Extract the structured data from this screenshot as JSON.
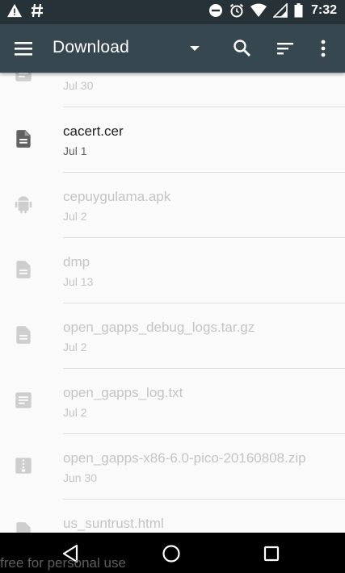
{
  "status_bar": {
    "time": "7:32",
    "left_icons": [
      "warning-icon",
      "hash-icon"
    ],
    "right_icons": [
      "do-not-disturb-icon",
      "alarm-icon",
      "wifi-icon",
      "signal-icon",
      "battery-icon"
    ]
  },
  "toolbar": {
    "title": "Download",
    "icons": [
      "menu-icon",
      "dropdown-arrow-icon",
      "search-icon",
      "sort-icon",
      "more-options-icon"
    ]
  },
  "files": [
    {
      "name": "",
      "date": "Jul 30",
      "icon": "text-file-icon",
      "enabled": false
    },
    {
      "name": "cacert.cer",
      "date": "Jul 1",
      "icon": "file-icon",
      "enabled": true
    },
    {
      "name": "cepuygulama.apk",
      "date": "Jul 2",
      "icon": "android-icon",
      "enabled": false
    },
    {
      "name": "dmp",
      "date": "Jul 13",
      "icon": "file-icon",
      "enabled": false
    },
    {
      "name": "open_gapps_debug_logs.tar.gz",
      "date": "Jul 2",
      "icon": "file-icon",
      "enabled": false
    },
    {
      "name": "open_gapps_log.txt",
      "date": "Jul 2",
      "icon": "text-file-icon",
      "enabled": false
    },
    {
      "name": "open_gapps-x86-6.0-pico-20160808.zip",
      "date": "Jun 30",
      "icon": "archive-icon",
      "enabled": false
    },
    {
      "name": "us_suntrust.html",
      "date": "",
      "icon": "file-icon",
      "enabled": false
    }
  ],
  "nav_bar": {
    "icons": [
      "back-icon",
      "home-icon",
      "recents-icon"
    ]
  },
  "watermark": "free for personal use"
}
